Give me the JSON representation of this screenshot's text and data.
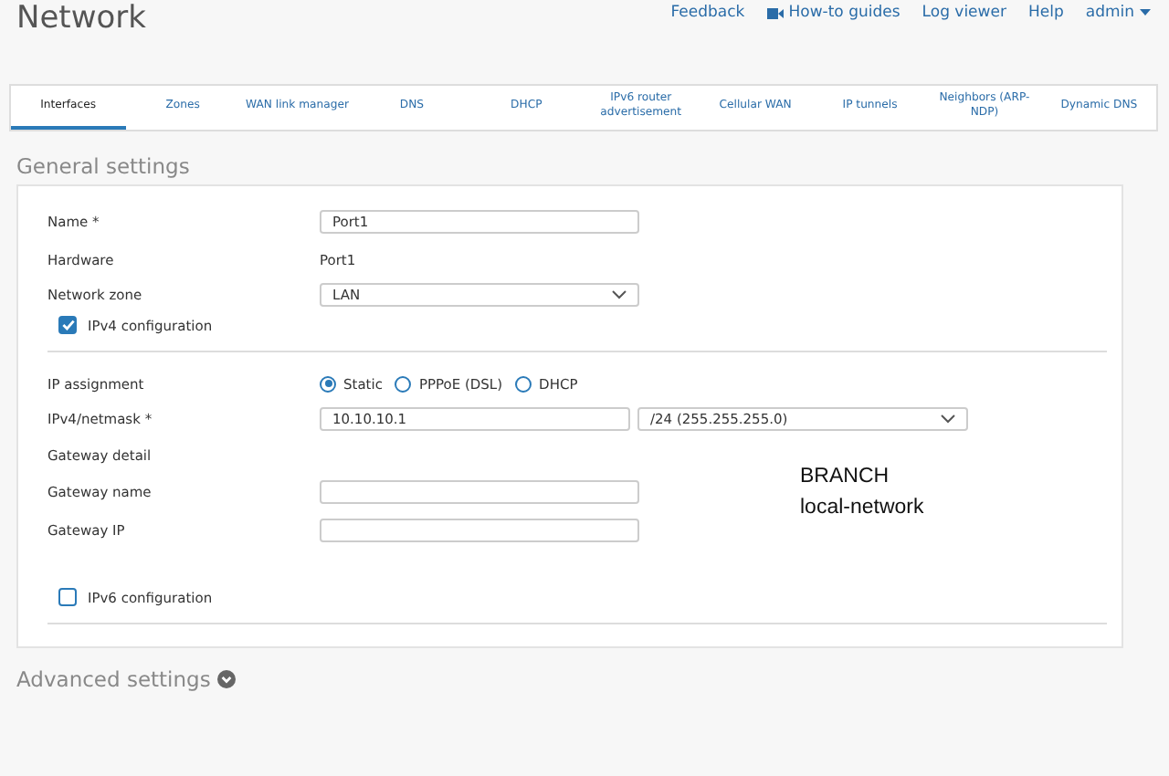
{
  "title": "Network",
  "top_links": [
    {
      "label": "Feedback",
      "kind": "link"
    },
    {
      "label": "How-to guides",
      "kind": "video"
    },
    {
      "label": "Log viewer",
      "kind": "link"
    },
    {
      "label": "Help",
      "kind": "link"
    },
    {
      "label": "admin",
      "kind": "menu"
    }
  ],
  "tabs": [
    {
      "label": "Interfaces",
      "selected": true
    },
    {
      "label": "Zones",
      "selected": false
    },
    {
      "label": "WAN link manager",
      "selected": false
    },
    {
      "label": "DNS",
      "selected": false
    },
    {
      "label": "DHCP",
      "selected": false
    },
    {
      "label": "IPv6 router advertisement",
      "selected": false
    },
    {
      "label": "Cellular WAN",
      "selected": false
    },
    {
      "label": "IP tunnels",
      "selected": false
    },
    {
      "label": "Neighbors (ARP-NDP)",
      "selected": false
    },
    {
      "label": "Dynamic DNS",
      "selected": false
    }
  ],
  "general_settings": {
    "heading": "General settings",
    "name": {
      "label": "Name *",
      "value": "Port1"
    },
    "hardware": {
      "label": "Hardware",
      "value": "Port1"
    },
    "network_zone": {
      "label": "Network zone",
      "value": "LAN"
    },
    "ipv4": {
      "label": "IPv4 configuration",
      "checked": true
    },
    "ip_assignment": {
      "label": "IP assignment",
      "options": [
        {
          "label": "Static",
          "selected": true
        },
        {
          "label": "PPPoE (DSL)",
          "selected": false
        },
        {
          "label": "DHCP",
          "selected": false
        }
      ]
    },
    "ipv4_netmask": {
      "label": "IPv4/netmask *",
      "address": "10.10.10.1",
      "netmask": "/24 (255.255.255.0)"
    },
    "gateway_detail": {
      "label": "Gateway detail"
    },
    "gateway_name": {
      "label": "Gateway name"
    },
    "gateway_ip": {
      "label": "Gateway IP"
    },
    "annotation": [
      "BRANCH",
      "local-network"
    ],
    "ipv6": {
      "label": "IPv6 configuration",
      "checked": false
    }
  },
  "advanced": {
    "label": "Advanced settings",
    "expanded": false
  }
}
